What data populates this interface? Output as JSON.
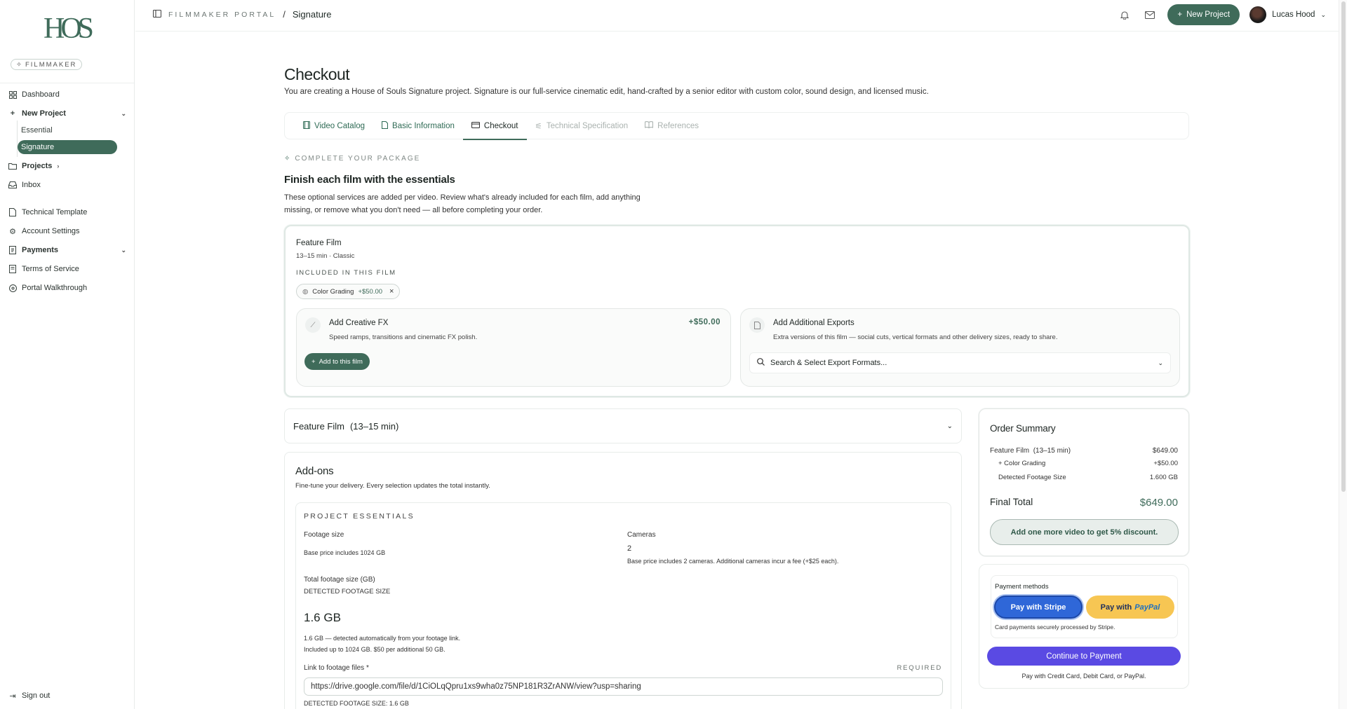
{
  "brand": {
    "logo_text": "HOS",
    "badge": "FILMMAKER"
  },
  "sidebar": {
    "items": [
      {
        "label": "Dashboard",
        "icon": "grid-icon"
      },
      {
        "label": "New Project",
        "icon": "plus-icon"
      },
      {
        "label": "Projects",
        "icon": "folder-icon"
      },
      {
        "label": "Inbox",
        "icon": "inbox-icon"
      },
      {
        "label": "Technical Template",
        "icon": "document-icon"
      },
      {
        "label": "Account Settings",
        "icon": "gear-icon"
      },
      {
        "label": "Payments",
        "icon": "receipt-icon"
      },
      {
        "label": "Terms of Service",
        "icon": "document-icon"
      },
      {
        "label": "Portal Walkthrough",
        "icon": "compass-icon"
      }
    ],
    "sub_items": [
      {
        "label": "Essential",
        "active": false
      },
      {
        "label": "Signature",
        "active": true
      }
    ],
    "sign_out": "Sign out"
  },
  "header": {
    "portal": "FILMMAKER PORTAL",
    "separator": "/",
    "current": "Signature",
    "new_project": "New Project",
    "user": "Lucas Hood"
  },
  "page": {
    "title": "Checkout",
    "description": "You are creating a House of Souls Signature project. Signature is our full-service cinematic edit, hand-crafted by a senior editor with custom color, sound design, and licensed music."
  },
  "tabs": [
    {
      "label": "Video Catalog",
      "state": "done"
    },
    {
      "label": "Basic Information",
      "state": "done"
    },
    {
      "label": "Checkout",
      "state": "active"
    },
    {
      "label": "Technical Specification",
      "state": "disabled"
    },
    {
      "label": "References",
      "state": "disabled"
    }
  ],
  "package": {
    "kicker": "COMPLETE YOUR PACKAGE",
    "title": "Finish each film with the essentials",
    "description": "These optional services are added per video. Review what's already included for each film, add anything missing, or remove what you don't need — all before completing your order."
  },
  "film_card": {
    "name": "Feature Film",
    "meta": "13–15 min · Classic",
    "included_label": "INCLUDED IN THIS FILM",
    "chip_label": "Color Grading",
    "chip_price": "+$50.00",
    "fx": {
      "title": "Add Creative FX",
      "description": "Speed ramps, transitions and cinematic FX polish.",
      "price": "+$50.00",
      "button": "Add to this film"
    },
    "exports": {
      "title": "Add Additional Exports",
      "description": "Extra versions of this film — social cuts, vertical formats and other delivery sizes, ready to share.",
      "placeholder": "Search & Select Export Formats..."
    }
  },
  "accordion": {
    "title": "Feature Film",
    "subtitle": "(13–15 min)"
  },
  "addons": {
    "title": "Add-ons",
    "description": "Fine-tune your delivery. Every selection updates the total instantly.",
    "essentials": {
      "kicker": "PROJECT ESSENTIALS",
      "footage_label": "Footage size",
      "footage_note": "Base price includes 1024 GB",
      "cameras_label": "Cameras",
      "cameras_value": "2",
      "cameras_note": "Base price includes 2 cameras. Additional cameras incur a fee (+$25 each).",
      "total_label": "Total footage size (GB)",
      "detected_label": "DETECTED FOOTAGE SIZE",
      "detected_value": "1.6 GB",
      "detected_note1": "1.6 GB — detected automatically from your footage link.",
      "detected_note2": "Included up to 1024 GB. $50 per additional 50 GB.",
      "link_label": "Link to footage files *",
      "required": "REQUIRED",
      "link_value": "https://drive.google.com/file/d/1CiOLqQpru1xs9wha0z75NP181R3ZrANW/view?usp=sharing",
      "detected_footer": "DETECTED FOOTAGE SIZE: 1.6 GB"
    }
  },
  "summary": {
    "title": "Order Summary",
    "film_label": "Feature Film",
    "film_sub": "(13–15 min)",
    "film_price": "$649.00",
    "color_label": "+ Color Grading",
    "color_price": "+$50.00",
    "footage_label": "Detected Footage Size",
    "footage_value": "1.600 GB",
    "total_label": "Final Total",
    "total_value": "$649.00",
    "discount": "Add one more video to get 5% discount."
  },
  "payment": {
    "methods_label": "Payment methods",
    "stripe": "Pay with Stripe",
    "paypal_prefix": "Pay with",
    "paypal_brand": "PayPal",
    "note": "Card payments securely processed by Stripe.",
    "continue": "Continue to Payment",
    "footer": "Pay with Credit Card, Debit Card, or PayPal."
  }
}
